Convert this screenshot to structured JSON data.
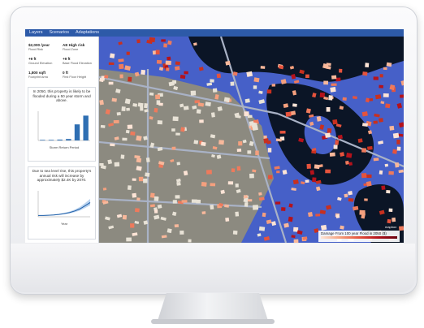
{
  "topbar": {
    "tabs": [
      "Layers",
      "Scenarios",
      "Adaptations"
    ]
  },
  "panel": {
    "tabs": {
      "value": "$2,000 /year",
      "middle": "AE",
      "right": "High risk"
    },
    "stats": [
      {
        "value": "$2,000 /year",
        "label": "Flood Risk"
      },
      {
        "value": "AE High risk",
        "label": "Flood Zone"
      },
      {
        "value": "+9 ft",
        "label": "Ground Elevation"
      },
      {
        "value": "+9 ft",
        "label": "Base Flood Elevation"
      },
      {
        "value": "1,800 sqft",
        "label": "Footprint Area"
      },
      {
        "value": "0 ft",
        "label": "First Floor Height"
      }
    ],
    "card1_text": "In 2050, this property is likely to be flooded during a 50 year storm and above.",
    "card1_xlabel": "Storm Return Period",
    "card2_text": "Due to sea level rise, this property's annual risk will increase by approximately $2.4K by 2070.",
    "card2_xlabel": "Year"
  },
  "chart_data": [
    {
      "type": "bar",
      "categories": [
        "",
        "",
        "",
        "",
        "",
        ""
      ],
      "values": [
        0.02,
        0.02,
        0.03,
        0.05,
        0.55,
        0.85
      ],
      "xlabel": "Storm Return Period",
      "ylabel": "",
      "ylim": [
        0,
        1
      ]
    },
    {
      "type": "area",
      "x": [
        0,
        1,
        2,
        3,
        4,
        5,
        6,
        7,
        8,
        9,
        10
      ],
      "values": [
        0.05,
        0.05,
        0.06,
        0.07,
        0.09,
        0.12,
        0.16,
        0.22,
        0.3,
        0.42,
        0.55
      ],
      "xlabel": "Year",
      "ylabel": "",
      "ylim": [
        0,
        1
      ]
    }
  ],
  "map": {
    "controls": [
      "+",
      "−",
      "⊕",
      "⌂",
      "●"
    ],
    "legend_title": "Damage From 100 year Flood in 2050 ($)",
    "legend_ticks": [
      "",
      "",
      "",
      "",
      "",
      ""
    ],
    "attribution": "mapbox",
    "colors": {
      "water": "#0b1526",
      "flood": "#4660c8",
      "damage_low": "#f5a07e",
      "damage_high": "#b5121b",
      "land": "#8c8a80"
    }
  }
}
